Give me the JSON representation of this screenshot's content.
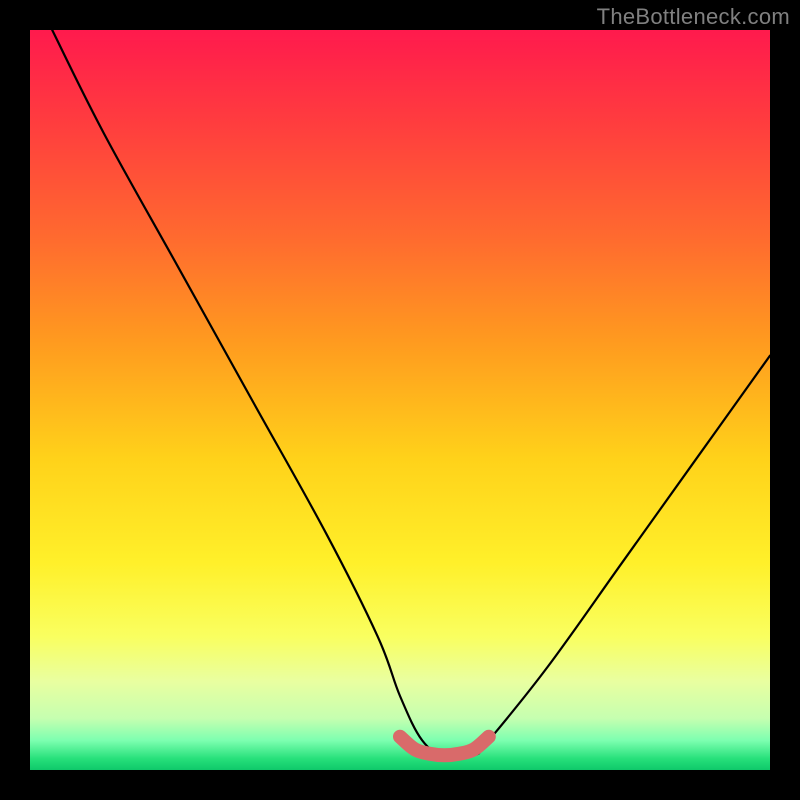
{
  "watermark": "TheBottleneck.com",
  "chart_data": {
    "type": "line",
    "title": "",
    "xlabel": "",
    "ylabel": "",
    "xlim": [
      0,
      100
    ],
    "ylim": [
      0,
      100
    ],
    "series": [
      {
        "name": "bottleneck-curve",
        "x": [
          3,
          10,
          20,
          30,
          40,
          47,
          50,
          53,
          56,
          60,
          62,
          70,
          80,
          90,
          100
        ],
        "values": [
          100,
          86,
          68,
          50,
          32,
          18,
          10,
          4,
          2,
          2,
          4,
          14,
          28,
          42,
          56
        ]
      }
    ],
    "marker_segment": {
      "name": "optimal-range",
      "x": [
        50,
        52,
        54,
        56,
        58,
        60,
        62
      ],
      "values": [
        4.5,
        2.8,
        2.2,
        2.0,
        2.2,
        2.8,
        4.5
      ]
    },
    "colors": {
      "curve": "#000000",
      "marker": "#d96a6a",
      "background_top": "#ff1a4d",
      "background_bottom": "#0fc86a",
      "frame": "#000000",
      "watermark": "#808080"
    }
  }
}
